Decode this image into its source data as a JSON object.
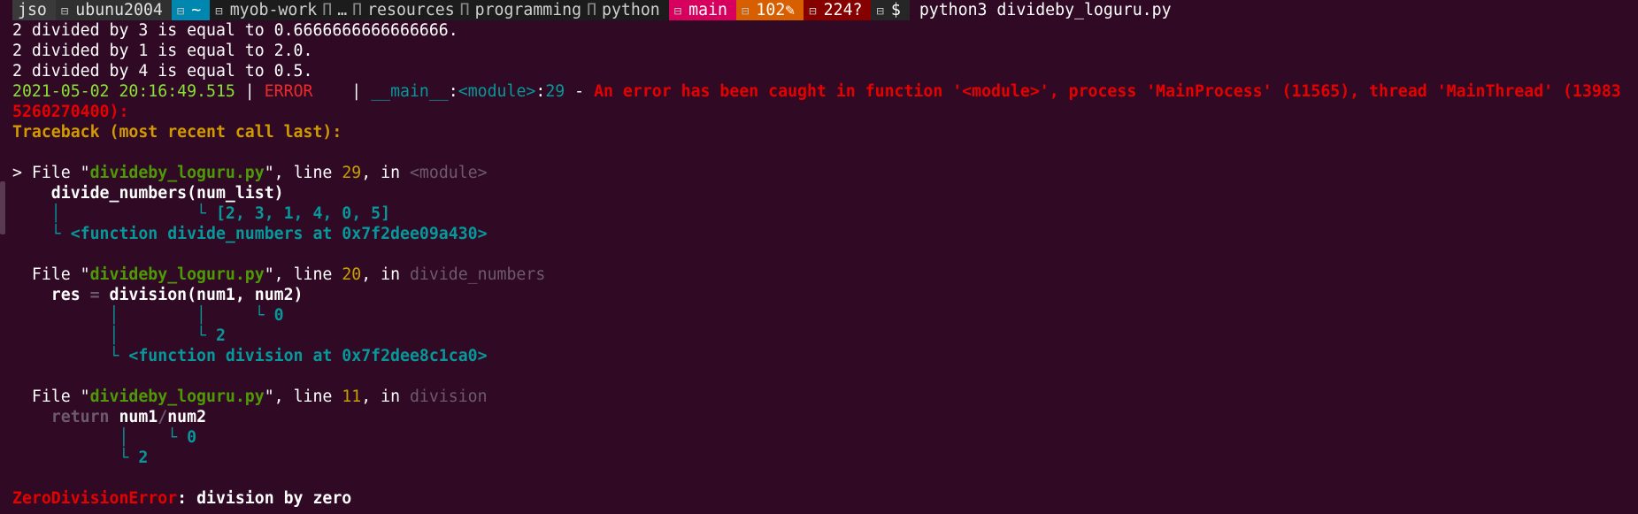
{
  "prompt": {
    "user": "jso",
    "host": "ubunu2004",
    "home": "~",
    "path_parts": [
      "myob-work",
      "…",
      "resources",
      "programming",
      "python"
    ],
    "branch": "main",
    "modified": "102✎",
    "untracked": "224?",
    "symbol": "$",
    "command": "python3 divideby_loguru.py"
  },
  "output": {
    "line1": "2 divided by 3 is equal to 0.6666666666666666.",
    "line2": "2 divided by 1 is equal to 2.0.",
    "line3": "2 divided by 4 is equal to 0.5.",
    "log_time": "2021-05-02 20:16:49.515",
    "log_sep1": " | ",
    "log_level": "ERROR   ",
    "log_sep2": " | ",
    "log_module": "__main__",
    "log_colon1": ":",
    "log_func": "<module>",
    "log_colon2": ":",
    "log_lineno": "29",
    "log_dash": " - ",
    "log_msg": "An error has been caught in function '<module>', process 'MainProcess' (11565), thread 'MainThread' (13983",
    "log_msg_cont": "5260270400):",
    "traceback_header": "Traceback (most recent call last):"
  },
  "frames": [
    {
      "prefix": "> File \"",
      "file": "divideby_loguru.py",
      "mid": "\", line ",
      "line": "29",
      "in": ", in ",
      "func": "<module>",
      "code": "    divide_numbers(num_list)",
      "vars": [
        "    │              └ [2, 3, 1, 4, 0, 5]",
        "    └ <function divide_numbers at 0x7f2dee09a430>"
      ]
    },
    {
      "prefix": "  File \"",
      "file": "divideby_loguru.py",
      "mid": "\", line ",
      "line": "20",
      "in": ", in ",
      "func": "divide_numbers",
      "code_res": "    res ",
      "code_eq": "=",
      "code_rest": " division(num1, num2)",
      "vars": [
        "          │        │     └ 0",
        "          │        └ 2",
        "          └ <function division at 0x7f2dee8c1ca0>"
      ]
    },
    {
      "prefix": "  File \"",
      "file": "divideby_loguru.py",
      "mid": "\", line ",
      "line": "11",
      "in": ", in ",
      "func": "division",
      "code_kw": "    return ",
      "code_a": "num1",
      "code_op": "/",
      "code_b": "num2",
      "vars": [
        "           │    └ 0",
        "           └ 2"
      ]
    }
  ],
  "error": {
    "name": "ZeroDivisionError",
    "colon": ": ",
    "message": "division by zero"
  }
}
